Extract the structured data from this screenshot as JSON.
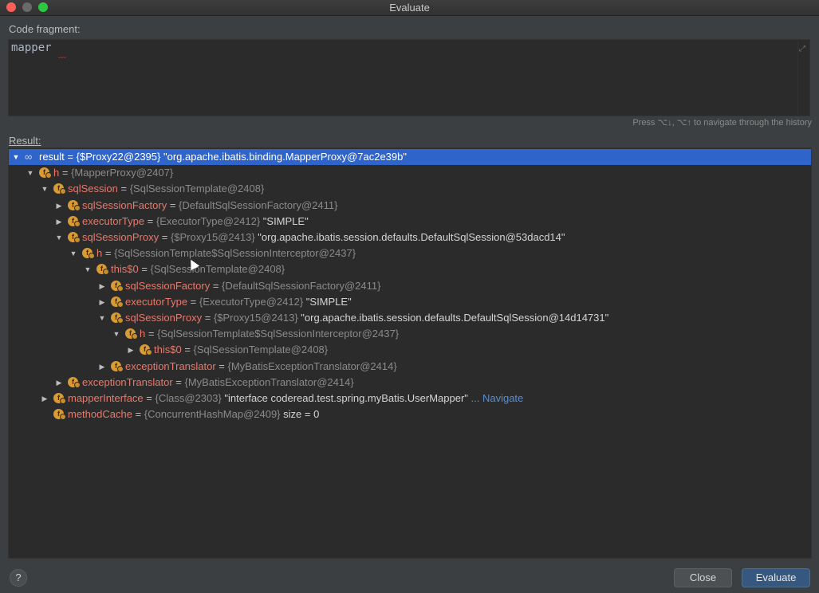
{
  "window": {
    "title": "Evaluate"
  },
  "code": {
    "label": "Code fragment:",
    "text": "mapper"
  },
  "hint": "Press ⌥↓, ⌥↑ to navigate through the history",
  "result": {
    "label": "Result:"
  },
  "tree": [
    {
      "name": "result",
      "eq": " = ",
      "type": "{$Proxy22@2395}",
      "value": " \"org.apache.ibatis.binding.MapperProxy@7ac2e39b\"",
      "expanded": true,
      "selected": true,
      "icon": "watch"
    },
    {
      "name": "h",
      "eq": " = ",
      "type": "{MapperProxy@2407}",
      "value": "",
      "expanded": true
    },
    {
      "name": "sqlSession",
      "eq": " = ",
      "type": "{SqlSessionTemplate@2408}",
      "value": "",
      "expanded": true
    },
    {
      "name": "sqlSessionFactory",
      "eq": " = ",
      "type": "{DefaultSqlSessionFactory@2411}",
      "value": "",
      "expanded": false
    },
    {
      "name": "executorType",
      "eq": " = ",
      "type": "{ExecutorType@2412}",
      "value": " \"SIMPLE\"",
      "expanded": false
    },
    {
      "name": "sqlSessionProxy",
      "eq": " = ",
      "type": "{$Proxy15@2413}",
      "value": " \"org.apache.ibatis.session.defaults.DefaultSqlSession@53dacd14\"",
      "expanded": true
    },
    {
      "name": "h",
      "eq": " = ",
      "type": "{SqlSessionTemplate$SqlSessionInterceptor@2437}",
      "value": "",
      "expanded": true
    },
    {
      "name": "this$0",
      "eq": " = ",
      "type": "{SqlSessionTemplate@2408}",
      "value": "",
      "expanded": true
    },
    {
      "name": "sqlSessionFactory",
      "eq": " = ",
      "type": "{DefaultSqlSessionFactory@2411}",
      "value": "",
      "expanded": false
    },
    {
      "name": "executorType",
      "eq": " = ",
      "type": "{ExecutorType@2412}",
      "value": " \"SIMPLE\"",
      "expanded": false
    },
    {
      "name": "sqlSessionProxy",
      "eq": " = ",
      "type": "{$Proxy15@2413}",
      "value": " \"org.apache.ibatis.session.defaults.DefaultSqlSession@14d14731\"",
      "expanded": true
    },
    {
      "name": "h",
      "eq": " = ",
      "type": "{SqlSessionTemplate$SqlSessionInterceptor@2437}",
      "value": "",
      "expanded": true
    },
    {
      "name": "this$0",
      "eq": " = ",
      "type": "{SqlSessionTemplate@2408}",
      "value": "",
      "expanded": false
    },
    {
      "name": "exceptionTranslator",
      "eq": " = ",
      "type": "{MyBatisExceptionTranslator@2414}",
      "value": "",
      "expanded": false
    },
    {
      "name": "exceptionTranslator",
      "eq": " = ",
      "type": "{MyBatisExceptionTranslator@2414}",
      "value": "",
      "expanded": false
    },
    {
      "name": "mapperInterface",
      "eq": " = ",
      "type": "{Class@2303}",
      "value": " \"interface coderead.test.spring.myBatis.UserMapper\"",
      "expanded": false,
      "nav": " ... Navigate"
    },
    {
      "name": "methodCache",
      "eq": " = ",
      "type": "{ConcurrentHashMap@2409}",
      "value": "  size = 0",
      "leaf": true
    }
  ],
  "buttons": {
    "help": "?",
    "close": "Close",
    "evaluate": "Evaluate"
  }
}
